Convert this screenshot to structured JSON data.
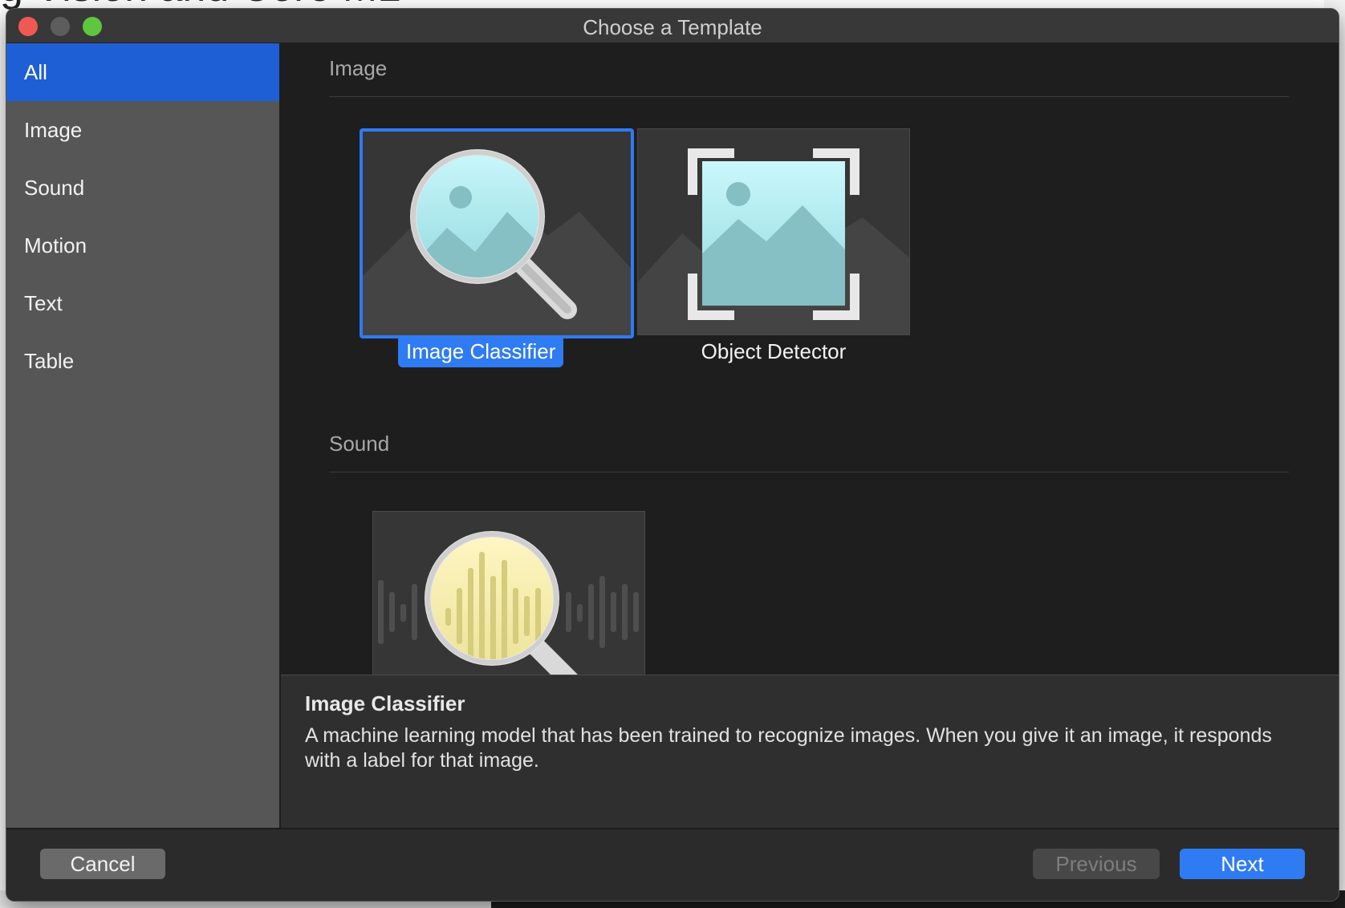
{
  "background": {
    "partial_text": "g Vision and Core ML"
  },
  "window": {
    "title": "Choose a Template"
  },
  "sidebar": {
    "items": [
      {
        "label": "All",
        "selected": true
      },
      {
        "label": "Image"
      },
      {
        "label": "Sound"
      },
      {
        "label": "Motion"
      },
      {
        "label": "Text"
      },
      {
        "label": "Table"
      }
    ]
  },
  "content": {
    "sections": [
      {
        "title": "Image",
        "templates": [
          {
            "label": "Image Classifier",
            "icon": "image-classifier-icon",
            "selected": true
          },
          {
            "label": "Object Detector",
            "icon": "object-detector-icon"
          }
        ]
      },
      {
        "title": "Sound",
        "templates": [
          {
            "label": "",
            "icon": "sound-classifier-icon"
          }
        ]
      }
    ]
  },
  "description": {
    "title": "Image Classifier",
    "text": "A machine learning model that has been trained to recognize images. When you give it an image, it responds with a label for that image."
  },
  "footer": {
    "cancel_label": "Cancel",
    "previous_label": "Previous",
    "next_label": "Next"
  },
  "colors": {
    "accent": "#2f7bf3",
    "sidebar_selected": "#1f5fd6",
    "sidebar_bg": "#565656",
    "content_bg": "#1e1e1e",
    "close": "#ee5a52",
    "maximize": "#5fc63f"
  }
}
